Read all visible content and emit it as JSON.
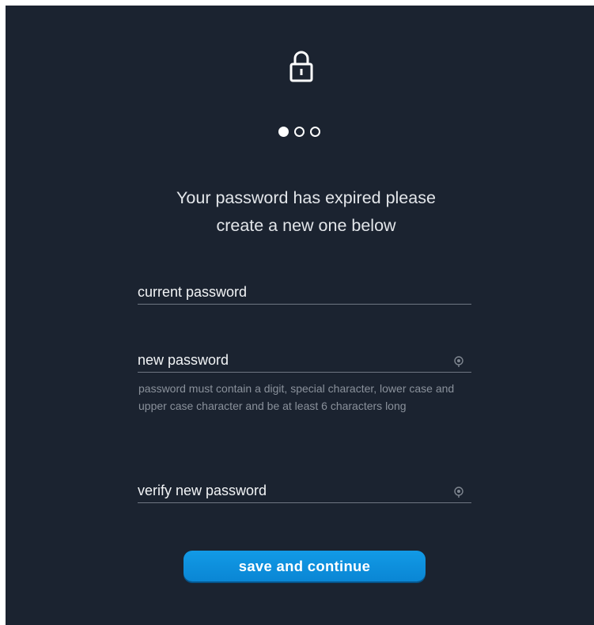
{
  "header": {
    "icon": "lock-icon",
    "steps": {
      "total": 3,
      "current": 1
    }
  },
  "heading": {
    "line1": "Your password has expired please",
    "line2": "create a new one below"
  },
  "form": {
    "current_password": {
      "placeholder": "current password",
      "value": ""
    },
    "new_password": {
      "placeholder": "new password",
      "value": "",
      "toggle_icon": "eye-icon",
      "hint": "password must contain a digit, special character, lower case and upper case character and be at least 6 characters long"
    },
    "verify_password": {
      "placeholder": "verify new password",
      "value": "",
      "toggle_icon": "eye-icon"
    },
    "submit_label": "save and continue"
  },
  "colors": {
    "background": "#1b2330",
    "accent": "#0f93e0",
    "hint_text": "#8a919b",
    "divider": "#6f7682"
  }
}
